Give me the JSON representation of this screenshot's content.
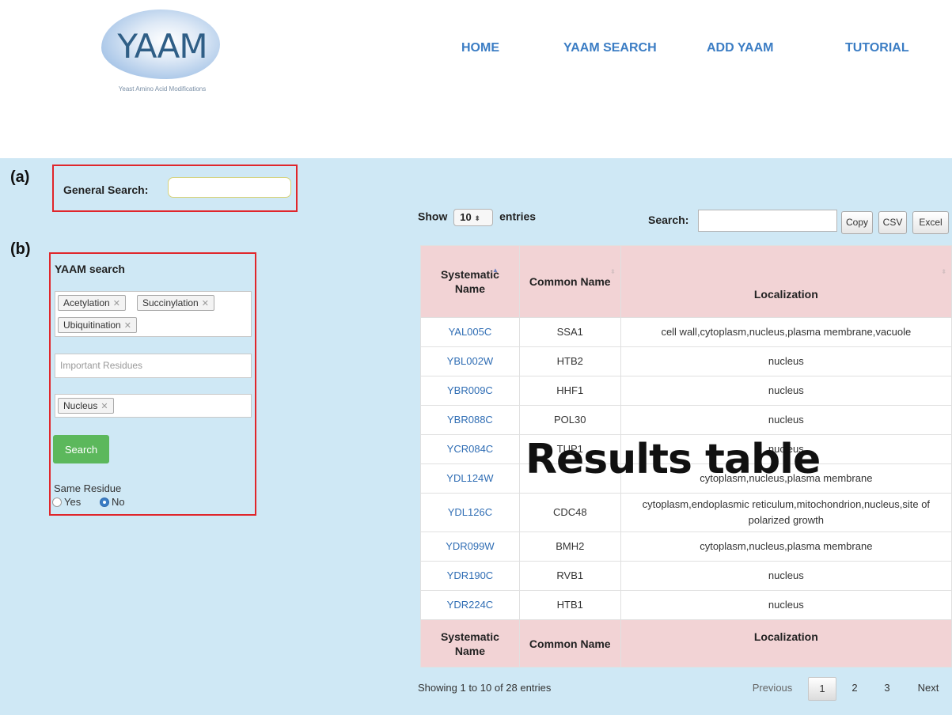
{
  "header": {
    "logo_text": "YAAM",
    "logo_tagline": "Yeast Amino Acid Modifications",
    "nav": [
      "HOME",
      "YAAM SEARCH",
      "ADD YAAM",
      "TUTORIAL"
    ]
  },
  "labels": {
    "a": "(a)",
    "b": "(b)",
    "overlay": "Results table"
  },
  "general_search": {
    "label": "General Search:",
    "value": ""
  },
  "yaam_search": {
    "title": "YAAM search",
    "modifications": [
      "Acetylation",
      "Succinylation",
      "Ubiquitination"
    ],
    "residues_placeholder": "Important Residues",
    "localization_tags": [
      "Nucleus"
    ],
    "search_button": "Search",
    "same_residue_label": "Same Residue",
    "options": [
      "Yes",
      "No"
    ],
    "selected": "No"
  },
  "table_controls": {
    "show_label": "Show",
    "entries_value": "10",
    "entries_label": "entries",
    "search_label": "Search:",
    "buttons": [
      "Copy",
      "CSV",
      "Excel"
    ]
  },
  "table": {
    "headers": [
      "Systematic Name",
      "Common Name",
      "Localization"
    ],
    "rows": [
      [
        "YAL005C",
        "SSA1",
        "cell wall,cytoplasm,nucleus,plasma membrane,vacuole"
      ],
      [
        "YBL002W",
        "HTB2",
        "nucleus"
      ],
      [
        "YBR009C",
        "HHF1",
        "nucleus"
      ],
      [
        "YBR088C",
        "POL30",
        "nucleus"
      ],
      [
        "YCR084C",
        "TUP1",
        "nucleus"
      ],
      [
        "YDL124W",
        "",
        "cytoplasm,nucleus,plasma membrane"
      ],
      [
        "YDL126C",
        "CDC48",
        "cytoplasm,endoplasmic reticulum,mitochondrion,nucleus,site of polarized growth"
      ],
      [
        "YDR099W",
        "BMH2",
        "cytoplasm,nucleus,plasma membrane"
      ],
      [
        "YDR190C",
        "RVB1",
        "nucleus"
      ],
      [
        "YDR224C",
        "HTB1",
        "nucleus"
      ]
    ]
  },
  "footer": {
    "info": "Showing 1 to 10 of 28 entries",
    "previous": "Previous",
    "pages": [
      "1",
      "2",
      "3"
    ],
    "next": "Next"
  },
  "colors": {
    "background": "#cfe8f5",
    "header_cell": "#f2d3d5",
    "link": "#3b7dc4",
    "highlight_box": "#e0262b",
    "search_button": "#5cb85c"
  }
}
